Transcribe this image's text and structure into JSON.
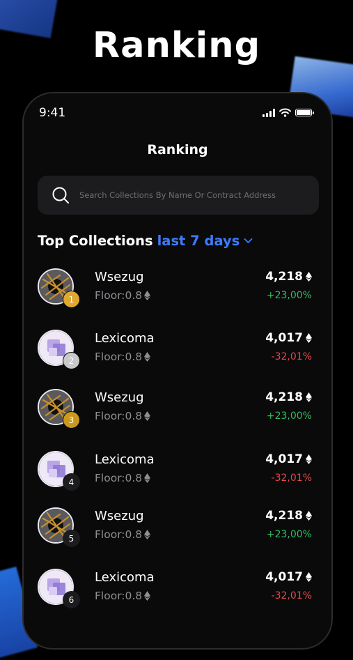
{
  "hero_title": "Ranking",
  "status": {
    "time": "9:41"
  },
  "screen_title": "Ranking",
  "search": {
    "placeholder": "Search Collections By Name Or Contract Address"
  },
  "section": {
    "title": "Top Collections",
    "period": "last 7 days"
  },
  "colors": {
    "accent": "#3d7bff",
    "positive": "#2fbf5e",
    "negative": "#e5484d",
    "gold": "#e0a82e",
    "silver": "#c9c9c9",
    "bronze": "#c99a1e"
  },
  "collections": [
    {
      "rank": "1",
      "name": "Wsezug",
      "floor": "Floor:0.8",
      "value": "4,218",
      "change": "+23,00%",
      "trend": "up",
      "image": "sticks"
    },
    {
      "rank": "2",
      "name": "Lexicoma",
      "floor": "Floor:0.8",
      "value": "4,017",
      "change": "-32,01%",
      "trend": "down",
      "image": "cube"
    },
    {
      "rank": "3",
      "name": "Wsezug",
      "floor": "Floor:0.8",
      "value": "4,218",
      "change": "+23,00%",
      "trend": "up",
      "image": "sticks"
    },
    {
      "rank": "4",
      "name": "Lexicoma",
      "floor": "Floor:0.8",
      "value": "4,017",
      "change": "-32,01%",
      "trend": "down",
      "image": "cube"
    },
    {
      "rank": "5",
      "name": "Wsezug",
      "floor": "Floor:0.8",
      "value": "4,218",
      "change": "+23,00%",
      "trend": "up",
      "image": "sticks"
    },
    {
      "rank": "6",
      "name": "Lexicoma",
      "floor": "Floor:0.8",
      "value": "4,017",
      "change": "-32,01%",
      "trend": "down",
      "image": "cube"
    }
  ]
}
